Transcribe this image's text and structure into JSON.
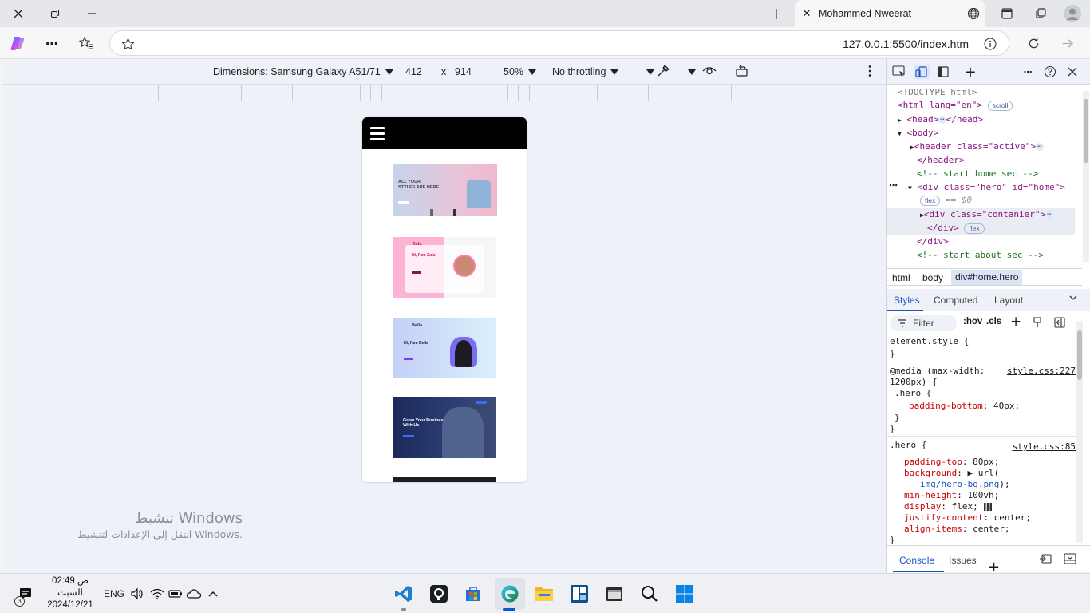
{
  "titlebar": {
    "tab_title": "Mohammed Nweerat",
    "window_controls": [
      "close-icon",
      "restore-icon",
      "minimize-icon"
    ],
    "new_tab_glyph": "+"
  },
  "address_bar": {
    "url": "127.0.0.1:5500/index.htm"
  },
  "device_toolbar": {
    "dimensions_label": "Dimensions: Samsung Galaxy A51/71",
    "width": "412",
    "times": "x",
    "height": "914",
    "zoom": "50%",
    "throttling": "No throttling"
  },
  "thumbnails": {
    "t1_line1": "ALL YOUR",
    "t1_line2": "STYLES ARE HERE",
    "t2_name": "Zulu",
    "t2_hi": "Hi, I'am Zulu",
    "t3_name": "Bella",
    "t3_hi": "Hi, I'am Bella",
    "t4_line1": "Grow Your Business",
    "t4_line2": "With Us"
  },
  "watermark": {
    "line1": "تنشيط Windows",
    "line2": "انتقل إلى الإعدادات لتنشيط Windows."
  },
  "devtools": {
    "dom": {
      "doctype": "<!DOCTYPE html>",
      "html_open": "<html lang=\"en\">",
      "scroll_badge": "scroll",
      "head": "<head>",
      "head_close": "</head>",
      "body": "<body>",
      "header_open": "<header class=\"active\">",
      "header_close": "</header>",
      "comment_home": "<!-- start home sec -->",
      "div_hero": "<div class=\"hero\" id=\"home\">",
      "flex_badge": "flex",
      "eq_sel": "== $0",
      "div_container": "<div class=\"contanier\">",
      "div_close_inner": "</div>",
      "div_close": "</div>",
      "comment_about": "<!-- start about sec -->"
    },
    "breadcrumbs": [
      "html",
      "body",
      "div#home.hero"
    ],
    "style_tabs": [
      "Styles",
      "Computed",
      "Layout"
    ],
    "filter_placeholder": "Filter",
    "hov": ":hov",
    "cls": ".cls",
    "styles": {
      "element_style": "element.style {",
      "close_brace": "}",
      "media_line1": "@media (max-width:",
      "media_line2": "1200px) {",
      "media_link": "style.css:227",
      "hero_sel": ".hero {",
      "padding_bottom_prop": "padding-bottom",
      "padding_bottom_val": ": 40px;",
      "hero_link": "style.css:85",
      "padding_top_prop": "padding-top",
      "padding_top_val": ": 80px;",
      "background_prop": "background",
      "background_val": ": ▶ url(",
      "background_url": "img/hero-bg.png",
      "background_end": ");",
      "min_height_prop": "min-height",
      "min_height_val": ": 100vh;",
      "display_prop": "display",
      "display_val": ": flex;",
      "justify_prop": "justify-content",
      "justify_val": ": center;",
      "align_prop": "align-items",
      "align_val": ": center;"
    },
    "bottom_tabs": [
      "Console",
      "Issues"
    ]
  },
  "taskbar": {
    "badge_count": "3",
    "time": "02:49 ص",
    "day": "السبت",
    "date": "2024/12/21",
    "lang": "ENG"
  },
  "colors": {
    "accent_blue": "#0b57d0",
    "dom_tag": "#881280",
    "dom_attr": "#994500",
    "dom_value": "#1a1aa6",
    "comment": "#236e25",
    "css_prop": "#c80000"
  }
}
